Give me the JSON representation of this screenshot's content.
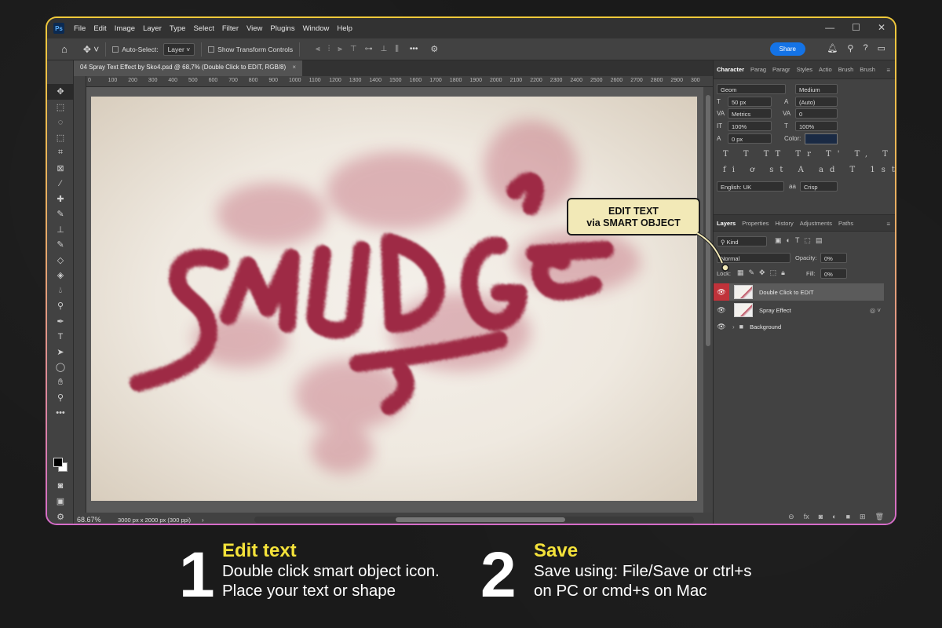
{
  "app": {
    "logo": "Ps",
    "menu": [
      "File",
      "Edit",
      "Image",
      "Layer",
      "Type",
      "Select",
      "Filter",
      "View",
      "Plugins",
      "Window",
      "Help"
    ],
    "window_controls": [
      "minimize-icon",
      "maximize-icon",
      "close-icon"
    ]
  },
  "options_bar": {
    "auto_select_label": "Auto-Select:",
    "auto_select_value": "Layer",
    "show_transform_label": "Show Transform Controls",
    "more_label": "•••",
    "share_label": "Share"
  },
  "document": {
    "tab_title": "04 Spray Text Effect by Sko4.psd @ 68,7% (Double Click to EDIT, RGB/8)",
    "tab_close": "×",
    "zoom": "68.67%",
    "doc_size": "3000 px x 2000 px (300 ppi)",
    "status_arrow": "›",
    "ruler_ticks": [
      "0",
      "100",
      "200",
      "300",
      "400",
      "500",
      "600",
      "700",
      "800",
      "900",
      "1000",
      "1100",
      "1200",
      "1300",
      "1400",
      "1500",
      "1600",
      "1700",
      "1800",
      "1900",
      "2000",
      "2100",
      "2200",
      "2300",
      "2400",
      "2500",
      "2600",
      "2700",
      "2800",
      "2900",
      "300"
    ]
  },
  "canvas_art": {
    "word": "SMUDGE",
    "ink_color": "#9e2a44"
  },
  "character_panel": {
    "tabs": [
      "Character",
      "Parag",
      "Paragr",
      "Styles",
      "Actio",
      "Brush",
      "Brush"
    ],
    "font_family": "Geom",
    "font_style": "Medium",
    "font_size": "50 px",
    "leading": "(Auto)",
    "kerning": "Metrics",
    "tracking": "0",
    "vscale": "100%",
    "hscale": "100%",
    "baseline": "0 px",
    "color_label": "Color:",
    "text_color": "#1a2a44",
    "glyphs_row1": "T T TT Tr T' T, T T",
    "glyphs_row2": "fi ơ st A ad T 1st ½",
    "language": "English: UK",
    "aa_label": "aa",
    "antialias": "Crisp"
  },
  "layers_panel": {
    "tabs": [
      "Layers",
      "Properties",
      "History",
      "Adjustments",
      "Paths"
    ],
    "filter": "Kind",
    "blend_mode": "Normal",
    "opacity_label": "Opacity:",
    "opacity": "0%",
    "lock_label": "Lock:",
    "fill_label": "Fill:",
    "fill": "0%",
    "layers": [
      {
        "name": "Double Click to EDIT",
        "selected": true
      },
      {
        "name": "Spray Effect",
        "selected": false
      },
      {
        "name": "Background",
        "selected": false
      }
    ]
  },
  "callout": {
    "line1": "EDIT TEXT",
    "line2": "via SMART OBJECT"
  },
  "instructions": [
    {
      "number": "1",
      "title": "Edit text",
      "lines": [
        "Double click smart object icon.",
        "Place your text or shape"
      ]
    },
    {
      "number": "2",
      "title": "Save",
      "lines": [
        "Save using: File/Save or ctrl+s",
        "on PC or cmd+s on Mac"
      ]
    }
  ],
  "colors": {
    "accent_blue": "#1473e6",
    "callout_bg": "#f2e9b7",
    "title_yellow": "#f4e23a",
    "layer_eye_red": "#c0323a"
  }
}
